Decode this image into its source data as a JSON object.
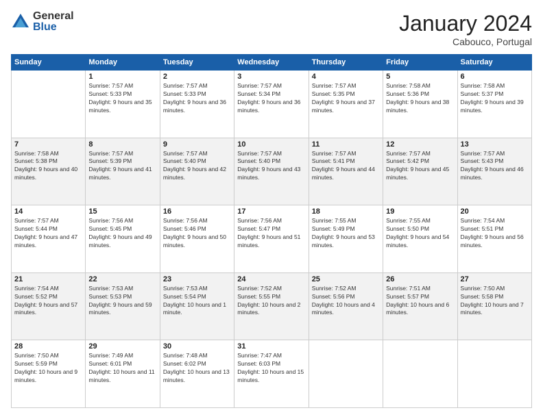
{
  "header": {
    "logo_general": "General",
    "logo_blue": "Blue",
    "month_title": "January 2024",
    "location": "Cabouco, Portugal"
  },
  "days_of_week": [
    "Sunday",
    "Monday",
    "Tuesday",
    "Wednesday",
    "Thursday",
    "Friday",
    "Saturday"
  ],
  "weeks": [
    {
      "shaded": false,
      "days": [
        {
          "number": "",
          "sunrise": "",
          "sunset": "",
          "daylight": ""
        },
        {
          "number": "1",
          "sunrise": "Sunrise: 7:57 AM",
          "sunset": "Sunset: 5:33 PM",
          "daylight": "Daylight: 9 hours and 35 minutes."
        },
        {
          "number": "2",
          "sunrise": "Sunrise: 7:57 AM",
          "sunset": "Sunset: 5:33 PM",
          "daylight": "Daylight: 9 hours and 36 minutes."
        },
        {
          "number": "3",
          "sunrise": "Sunrise: 7:57 AM",
          "sunset": "Sunset: 5:34 PM",
          "daylight": "Daylight: 9 hours and 36 minutes."
        },
        {
          "number": "4",
          "sunrise": "Sunrise: 7:57 AM",
          "sunset": "Sunset: 5:35 PM",
          "daylight": "Daylight: 9 hours and 37 minutes."
        },
        {
          "number": "5",
          "sunrise": "Sunrise: 7:58 AM",
          "sunset": "Sunset: 5:36 PM",
          "daylight": "Daylight: 9 hours and 38 minutes."
        },
        {
          "number": "6",
          "sunrise": "Sunrise: 7:58 AM",
          "sunset": "Sunset: 5:37 PM",
          "daylight": "Daylight: 9 hours and 39 minutes."
        }
      ]
    },
    {
      "shaded": true,
      "days": [
        {
          "number": "7",
          "sunrise": "Sunrise: 7:58 AM",
          "sunset": "Sunset: 5:38 PM",
          "daylight": "Daylight: 9 hours and 40 minutes."
        },
        {
          "number": "8",
          "sunrise": "Sunrise: 7:57 AM",
          "sunset": "Sunset: 5:39 PM",
          "daylight": "Daylight: 9 hours and 41 minutes."
        },
        {
          "number": "9",
          "sunrise": "Sunrise: 7:57 AM",
          "sunset": "Sunset: 5:40 PM",
          "daylight": "Daylight: 9 hours and 42 minutes."
        },
        {
          "number": "10",
          "sunrise": "Sunrise: 7:57 AM",
          "sunset": "Sunset: 5:40 PM",
          "daylight": "Daylight: 9 hours and 43 minutes."
        },
        {
          "number": "11",
          "sunrise": "Sunrise: 7:57 AM",
          "sunset": "Sunset: 5:41 PM",
          "daylight": "Daylight: 9 hours and 44 minutes."
        },
        {
          "number": "12",
          "sunrise": "Sunrise: 7:57 AM",
          "sunset": "Sunset: 5:42 PM",
          "daylight": "Daylight: 9 hours and 45 minutes."
        },
        {
          "number": "13",
          "sunrise": "Sunrise: 7:57 AM",
          "sunset": "Sunset: 5:43 PM",
          "daylight": "Daylight: 9 hours and 46 minutes."
        }
      ]
    },
    {
      "shaded": false,
      "days": [
        {
          "number": "14",
          "sunrise": "Sunrise: 7:57 AM",
          "sunset": "Sunset: 5:44 PM",
          "daylight": "Daylight: 9 hours and 47 minutes."
        },
        {
          "number": "15",
          "sunrise": "Sunrise: 7:56 AM",
          "sunset": "Sunset: 5:45 PM",
          "daylight": "Daylight: 9 hours and 49 minutes."
        },
        {
          "number": "16",
          "sunrise": "Sunrise: 7:56 AM",
          "sunset": "Sunset: 5:46 PM",
          "daylight": "Daylight: 9 hours and 50 minutes."
        },
        {
          "number": "17",
          "sunrise": "Sunrise: 7:56 AM",
          "sunset": "Sunset: 5:47 PM",
          "daylight": "Daylight: 9 hours and 51 minutes."
        },
        {
          "number": "18",
          "sunrise": "Sunrise: 7:55 AM",
          "sunset": "Sunset: 5:49 PM",
          "daylight": "Daylight: 9 hours and 53 minutes."
        },
        {
          "number": "19",
          "sunrise": "Sunrise: 7:55 AM",
          "sunset": "Sunset: 5:50 PM",
          "daylight": "Daylight: 9 hours and 54 minutes."
        },
        {
          "number": "20",
          "sunrise": "Sunrise: 7:54 AM",
          "sunset": "Sunset: 5:51 PM",
          "daylight": "Daylight: 9 hours and 56 minutes."
        }
      ]
    },
    {
      "shaded": true,
      "days": [
        {
          "number": "21",
          "sunrise": "Sunrise: 7:54 AM",
          "sunset": "Sunset: 5:52 PM",
          "daylight": "Daylight: 9 hours and 57 minutes."
        },
        {
          "number": "22",
          "sunrise": "Sunrise: 7:53 AM",
          "sunset": "Sunset: 5:53 PM",
          "daylight": "Daylight: 9 hours and 59 minutes."
        },
        {
          "number": "23",
          "sunrise": "Sunrise: 7:53 AM",
          "sunset": "Sunset: 5:54 PM",
          "daylight": "Daylight: 10 hours and 1 minute."
        },
        {
          "number": "24",
          "sunrise": "Sunrise: 7:52 AM",
          "sunset": "Sunset: 5:55 PM",
          "daylight": "Daylight: 10 hours and 2 minutes."
        },
        {
          "number": "25",
          "sunrise": "Sunrise: 7:52 AM",
          "sunset": "Sunset: 5:56 PM",
          "daylight": "Daylight: 10 hours and 4 minutes."
        },
        {
          "number": "26",
          "sunrise": "Sunrise: 7:51 AM",
          "sunset": "Sunset: 5:57 PM",
          "daylight": "Daylight: 10 hours and 6 minutes."
        },
        {
          "number": "27",
          "sunrise": "Sunrise: 7:50 AM",
          "sunset": "Sunset: 5:58 PM",
          "daylight": "Daylight: 10 hours and 7 minutes."
        }
      ]
    },
    {
      "shaded": false,
      "days": [
        {
          "number": "28",
          "sunrise": "Sunrise: 7:50 AM",
          "sunset": "Sunset: 5:59 PM",
          "daylight": "Daylight: 10 hours and 9 minutes."
        },
        {
          "number": "29",
          "sunrise": "Sunrise: 7:49 AM",
          "sunset": "Sunset: 6:01 PM",
          "daylight": "Daylight: 10 hours and 11 minutes."
        },
        {
          "number": "30",
          "sunrise": "Sunrise: 7:48 AM",
          "sunset": "Sunset: 6:02 PM",
          "daylight": "Daylight: 10 hours and 13 minutes."
        },
        {
          "number": "31",
          "sunrise": "Sunrise: 7:47 AM",
          "sunset": "Sunset: 6:03 PM",
          "daylight": "Daylight: 10 hours and 15 minutes."
        },
        {
          "number": "",
          "sunrise": "",
          "sunset": "",
          "daylight": ""
        },
        {
          "number": "",
          "sunrise": "",
          "sunset": "",
          "daylight": ""
        },
        {
          "number": "",
          "sunrise": "",
          "sunset": "",
          "daylight": ""
        }
      ]
    }
  ]
}
